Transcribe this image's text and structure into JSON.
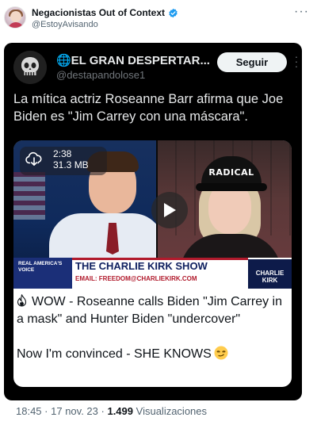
{
  "outer": {
    "name": "Negacionistas Out of Context",
    "handle": "@EstoyAvisando",
    "more_icon": "more-horizontal-icon"
  },
  "embed": {
    "name": "🌐EL GRAN DESPERTAR...",
    "handle": "@destapandolose1",
    "follow_label": "Seguir",
    "text": "La mítica actriz Roseanne Barr afirma que Joe Biden es \"Jim Carrey con una máscara\".",
    "card": {
      "video": {
        "duration": "2:38",
        "file_size": "31.3 MB",
        "cap_text": "RADICAL",
        "lower_third_logo": "REAL AMERICA'S VOICE",
        "lower_third_title": "THE CHARLIE KIRK SHOW",
        "lower_third_email": "EMAIL: FREEDOM@CHARLIEKIRK.COM",
        "lower_third_brand": "CHARLIE KIRK"
      },
      "text_line1": "WOW - Roseanne calls Biden \"Jim Carrey in a mask\" and Hunter Biden \"undercover\"",
      "text_line2": "Now I'm convinced - SHE KNOWS"
    }
  },
  "footer": {
    "time": "18:45",
    "date": "17 nov. 23",
    "views": "1.499",
    "views_label": "Visualizaciones"
  },
  "colors": {
    "verified": "#1d9bf0",
    "embed_bg": "#000000",
    "secondary_text": "#536471"
  }
}
